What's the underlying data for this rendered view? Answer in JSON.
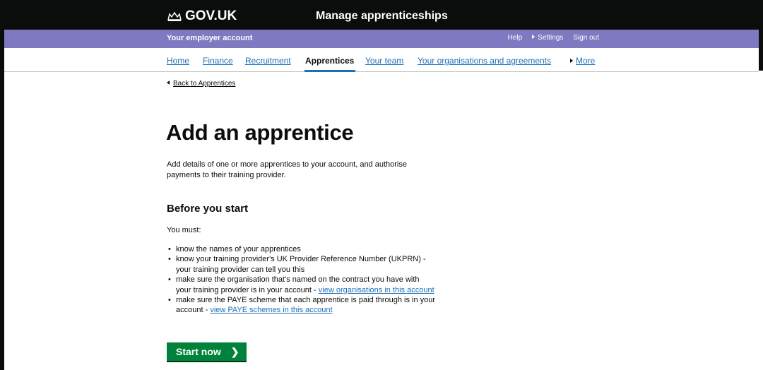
{
  "header": {
    "brand": "GOV.UK",
    "service_name": "Manage apprenticeships"
  },
  "account_bar": {
    "account_name": "Your employer account",
    "links": [
      "Help",
      "Settings",
      "Sign out"
    ]
  },
  "nav": {
    "items": [
      "Home",
      "Finance",
      "Recruitment",
      "Apprentices",
      "Your team",
      "Your organisations and agreements"
    ],
    "active": "Apprentices",
    "more": "More"
  },
  "back_link": "Back to Apprentices",
  "page": {
    "title": "Add an apprentice",
    "intro_line1": "Add details of one or more apprentices to your account, and authorise",
    "intro_line2": "payments to their training provider.",
    "before_heading": "Before you start",
    "you_must": "You must:",
    "req1": "know the names of your apprentices",
    "req2_line1": "know your training provider's UK Provider Reference Number (UKPRN) -",
    "req2_line2": "your training provider can tell you this",
    "req3_line1": "make sure the organisation that's named on the contract you have with",
    "req3_line2": "your training provider is in your account - ",
    "req3_link": "view organisations in this account",
    "req4_line1": "make sure the PAYE scheme that each apprentice is paid through is in your",
    "req4_line2": "account - ",
    "req4_link": "view PAYE schemes in this account",
    "start_button": "Start now"
  },
  "icons": {
    "crown": "crown-icon",
    "triangle": "triangle-right-icon",
    "back": "triangle-left-icon",
    "chevron": "chevron-right-icon"
  }
}
